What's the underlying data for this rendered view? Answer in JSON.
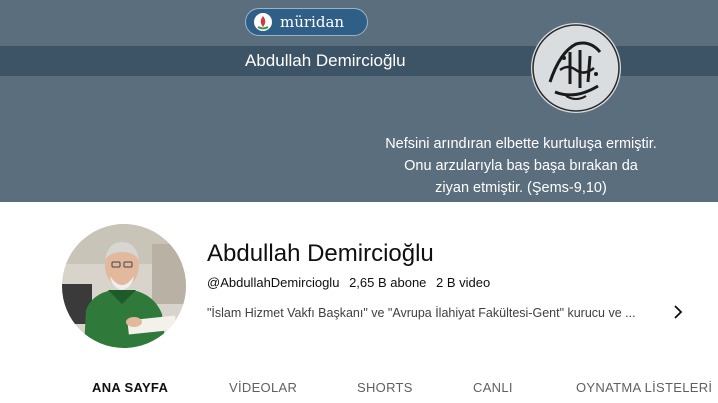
{
  "banner": {
    "logo_text": "müridan",
    "channel_name": "Abdullah Demircioğlu",
    "quote_lines": [
      "Nefsini arındıran elbette kurtuluşa ermiştir.",
      "Onu arzularıyla baş başa bırakan da",
      "ziyan etmiştir. (Şems-9,10)"
    ]
  },
  "channel": {
    "name": "Abdullah Demircioğlu",
    "handle": "@AbdullahDemircioglu",
    "subscribers": "2,65 B abone",
    "videos": "2 B video",
    "description": "\"İslam Hizmet Vakfı Başkanı\" ve \"Avrupa İlahiyat Fakültesi-Gent\" kurucu ve ..."
  },
  "tabs": [
    {
      "label": "ANA SAYFA",
      "active": true
    },
    {
      "label": "VİDEOLAR",
      "active": false
    },
    {
      "label": "SHORTS",
      "active": false
    },
    {
      "label": "CANLI",
      "active": false
    },
    {
      "label": "OYNATMA LİSTELERİ",
      "active": false
    }
  ],
  "colors": {
    "banner_bg": "#5b6e7d",
    "banner_band": "#3d5466",
    "logo_bg": "#2f5f87"
  },
  "icons": {
    "more": "chevron-right-icon"
  }
}
